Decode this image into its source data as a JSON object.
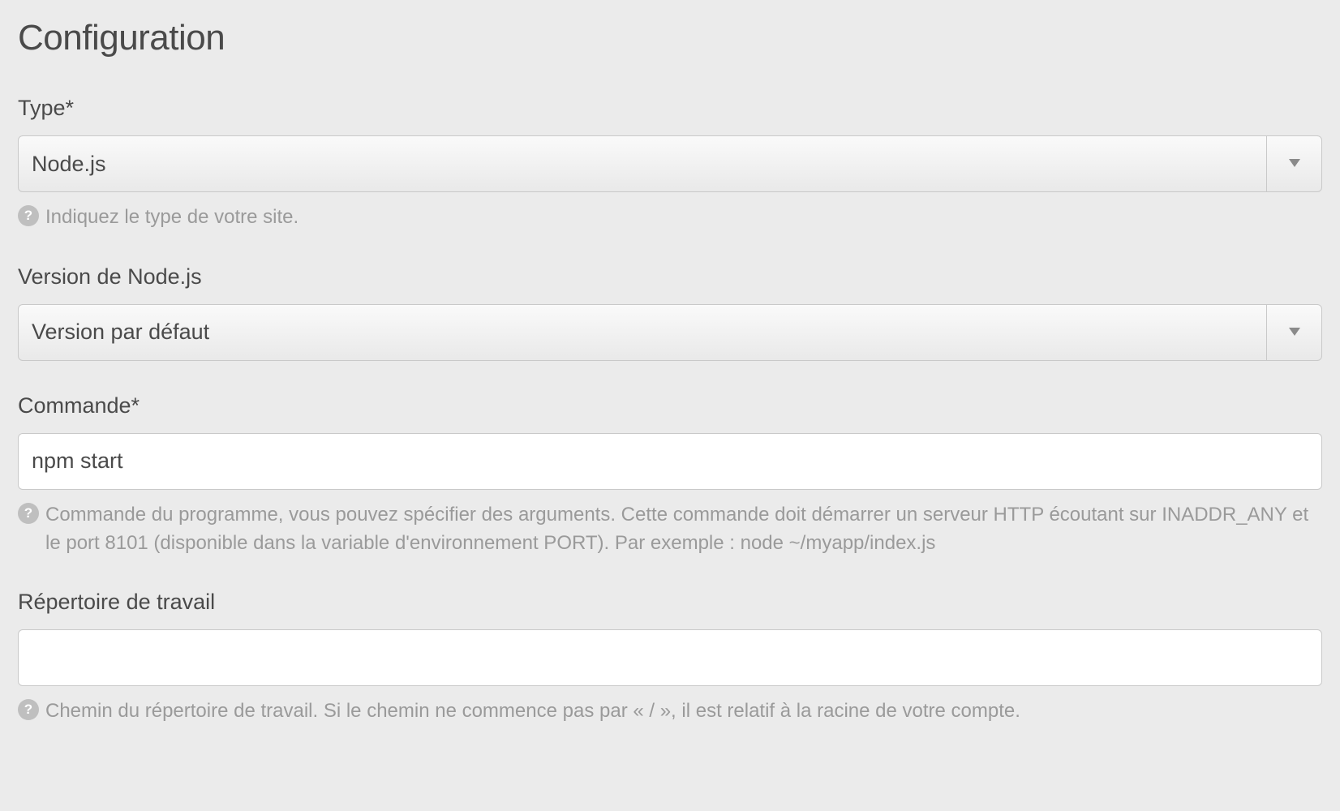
{
  "title": "Configuration",
  "fields": {
    "type": {
      "label": "Type*",
      "value": "Node.js",
      "help": "Indiquez le type de votre site."
    },
    "nodeVersion": {
      "label": "Version de Node.js",
      "value": "Version par défaut"
    },
    "command": {
      "label": "Commande*",
      "value": "npm start",
      "help": "Commande du programme, vous pouvez spécifier des arguments. Cette commande doit démarrer un serveur HTTP écoutant sur INADDR_ANY et le port 8101 (disponible dans la variable d'environnement PORT). Par exemple : node ~/myapp/index.js"
    },
    "workdir": {
      "label": "Répertoire de travail",
      "value": "",
      "help": "Chemin du répertoire de travail. Si le chemin ne commence pas par « / », il est relatif à la racine de votre compte."
    }
  }
}
